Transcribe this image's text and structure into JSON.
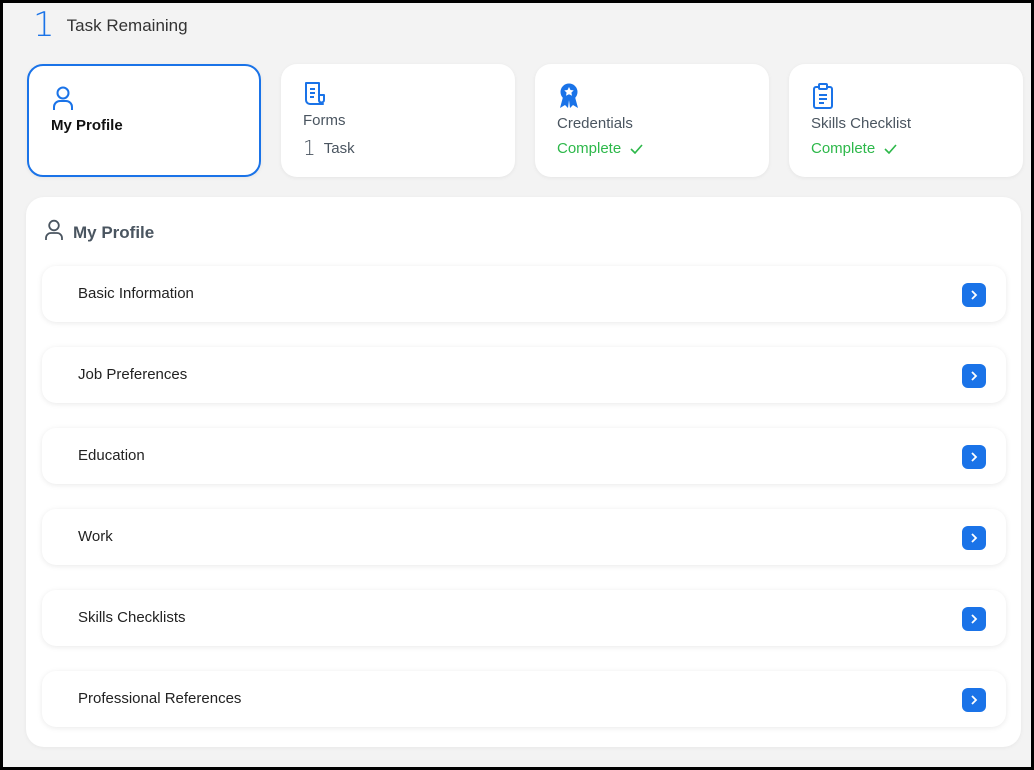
{
  "summary": {
    "count": "1",
    "label": "Task Remaining"
  },
  "cards": [
    {
      "title": "My Profile",
      "icon": "user-icon"
    },
    {
      "title": "Forms",
      "icon": "document-icon",
      "tasks_count": "1",
      "tasks_label": "Task"
    },
    {
      "title": "Credentials",
      "icon": "award-ribbon-icon",
      "status": "Complete"
    },
    {
      "title": "Skills Checklist",
      "icon": "clipboard-icon",
      "status": "Complete"
    }
  ],
  "panel": {
    "title": "My Profile",
    "items": [
      {
        "label": "Basic Information"
      },
      {
        "label": "Job Preferences"
      },
      {
        "label": "Education"
      },
      {
        "label": "Work"
      },
      {
        "label": "Skills Checklists"
      },
      {
        "label": "Professional References"
      }
    ]
  },
  "colors": {
    "accent": "#1a73e8",
    "success": "#2db84a",
    "muted_text": "#4a5560"
  }
}
